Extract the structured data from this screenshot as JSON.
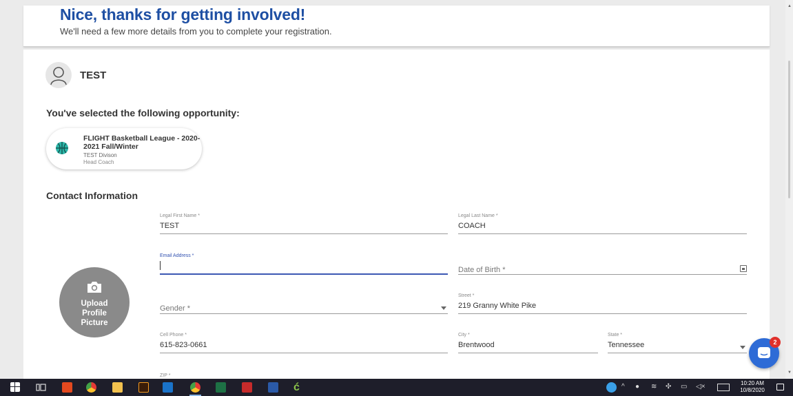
{
  "header": {
    "title": "Nice, thanks for getting involved!",
    "subtitle": "We'll need a few more details from you to complete your registration."
  },
  "user": {
    "name": "TEST"
  },
  "opportunity": {
    "heading": "You've selected the following opportunity:",
    "title": "FLIGHT Basketball League - 2020-2021 Fall/Winter",
    "division": "TEST Divison",
    "role": "Head Coach",
    "icon": "basketball-icon"
  },
  "contact": {
    "heading": "Contact Information",
    "upload_label": "Upload\nProfile\nPicture",
    "fields": {
      "first_name": {
        "label": "Legal First Name *",
        "value": "TEST"
      },
      "last_name": {
        "label": "Legal Last Name *",
        "value": "COACH"
      },
      "email": {
        "label": "Email Address *",
        "value": ""
      },
      "dob": {
        "placeholder": "Date of Birth *"
      },
      "gender": {
        "placeholder": "Gender *"
      },
      "street": {
        "label": "Street *",
        "value": "219 Granny White Pike"
      },
      "cell_phone": {
        "label": "Cell Phone *",
        "value": "615-823-0661"
      },
      "city": {
        "label": "City *",
        "value": "Brentwood"
      },
      "state": {
        "label": "State *",
        "value": "Tennessee"
      },
      "zip": {
        "label": "ZIP *"
      }
    }
  },
  "chat": {
    "badge_count": "2",
    "color": "#2e6bd6"
  },
  "taskbar": {
    "time": "10:20 AM",
    "date": "10/8/2020"
  },
  "colors": {
    "title_blue": "#1e4fa3",
    "focus_blue": "#3b57b3",
    "badge_red": "#e0302b"
  }
}
